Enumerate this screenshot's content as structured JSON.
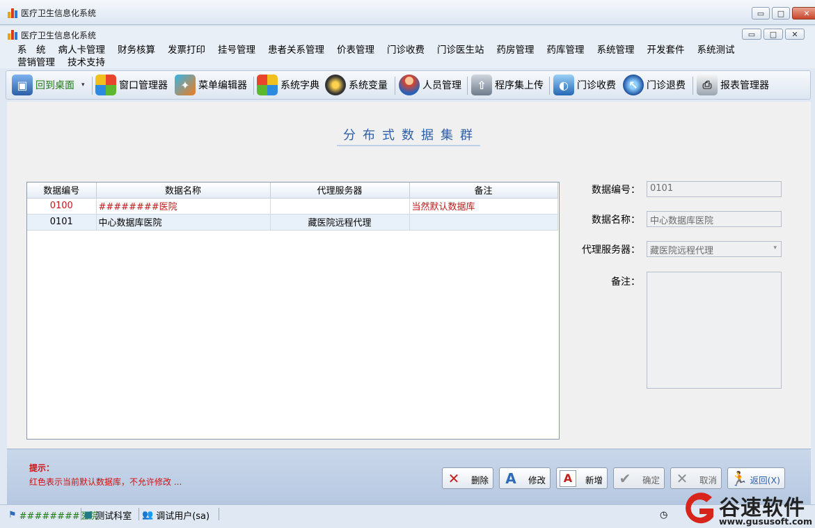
{
  "window": {
    "title": "医疗卫生信息化系统",
    "child_title": "医疗卫生信息化系统",
    "buttons": {
      "minimize": "▭",
      "maximize": "□",
      "close": "✕"
    }
  },
  "menu": {
    "row1": [
      "系　统",
      "病人卡管理",
      "财务核算",
      "发票打印",
      "挂号管理",
      "患者关系管理",
      "价表管理",
      "门诊收费",
      "门诊医生站",
      "药房管理",
      "药库管理",
      "系统管理",
      "开发套件",
      "系统测试"
    ],
    "row2": [
      "营销管理",
      "技术支持"
    ]
  },
  "toolbar": {
    "items": [
      "回到桌面",
      "窗口管理器",
      "菜单编辑器",
      "系统字典",
      "系统变量",
      "人员管理",
      "程序集上传",
      "门诊收费",
      "门诊退费",
      "报表管理器"
    ],
    "dropdown_arrow": "▾"
  },
  "page": {
    "heading": "分布式数据集群"
  },
  "grid": {
    "columns": [
      "数据编号",
      "数据名称",
      "代理服务器",
      "备注"
    ],
    "rows": [
      {
        "id": "0100",
        "name": "########医院",
        "proxy": "",
        "note": "当然默认数据库"
      },
      {
        "id": "0101",
        "name": "中心数据库医院",
        "proxy": "藏医院远程代理",
        "note": ""
      }
    ]
  },
  "form": {
    "id_label": "数据编号：",
    "id_value": "0101",
    "name_label": "数据名称：",
    "name_value": "中心数据库医院",
    "proxy_label": "代理服务器：",
    "proxy_value": "藏医院远程代理",
    "note_label": "备注："
  },
  "hint": {
    "title": "提示：",
    "text": "红色表示当前默认数据库，不允许修改 ..."
  },
  "buttons": {
    "delete": "删除",
    "modify": "修改",
    "add": "新增",
    "confirm": "确定",
    "cancel": "取消",
    "back": "返回(X)"
  },
  "statusbar": {
    "hospital": "########医院",
    "department": "测试科室",
    "user": "调试用户(sa)"
  },
  "watermark": {
    "text": "谷速软件",
    "url": "www.gususoft.com"
  },
  "colors": {
    "accent": "#2f5fa6",
    "default_row": "#c11a1a",
    "hint": "#d01010"
  }
}
